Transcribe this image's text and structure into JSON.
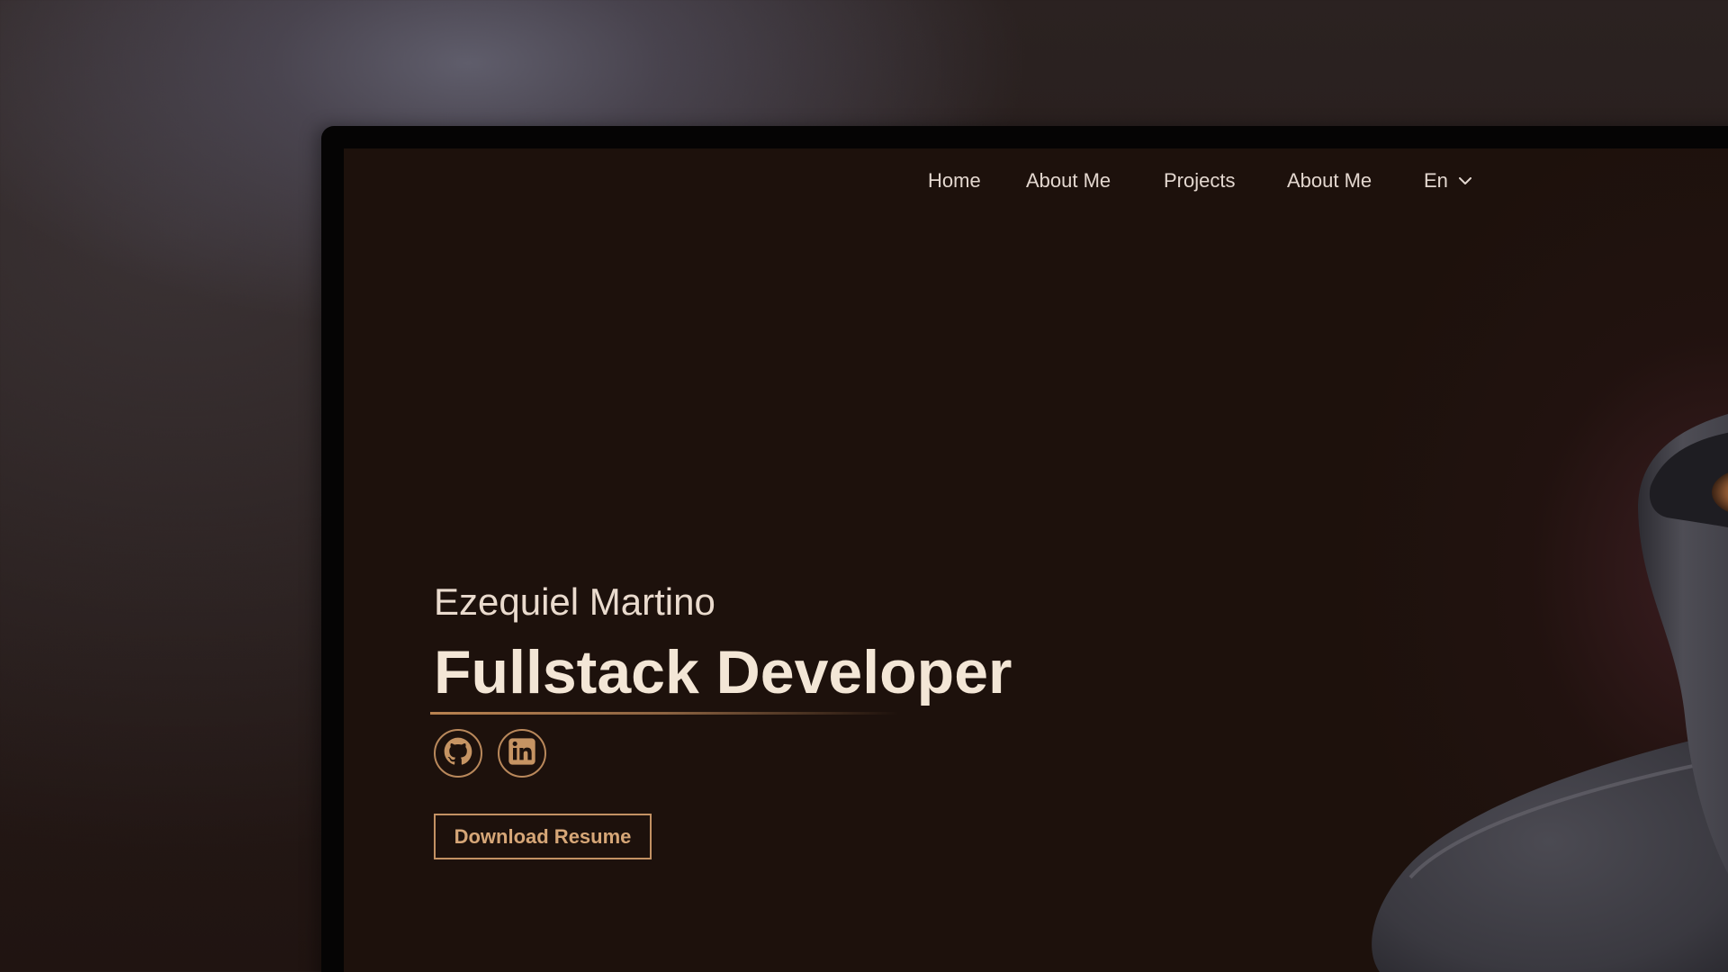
{
  "nav": {
    "items": [
      {
        "label": "Home"
      },
      {
        "label": "About Me"
      },
      {
        "label": "Projects"
      },
      {
        "label": "About Me"
      }
    ],
    "language": "En"
  },
  "hero": {
    "name": "Ezequiel Martino",
    "role": "Fullstack Developer",
    "socials": [
      {
        "icon": "github-icon"
      },
      {
        "icon": "linkedin-icon"
      }
    ],
    "resume_label": "Download Resume"
  },
  "colors": {
    "screen_bg": "#1d110c",
    "accent": "#c39163",
    "text": "#e3d7cf",
    "heading": "#f3e6d6"
  }
}
